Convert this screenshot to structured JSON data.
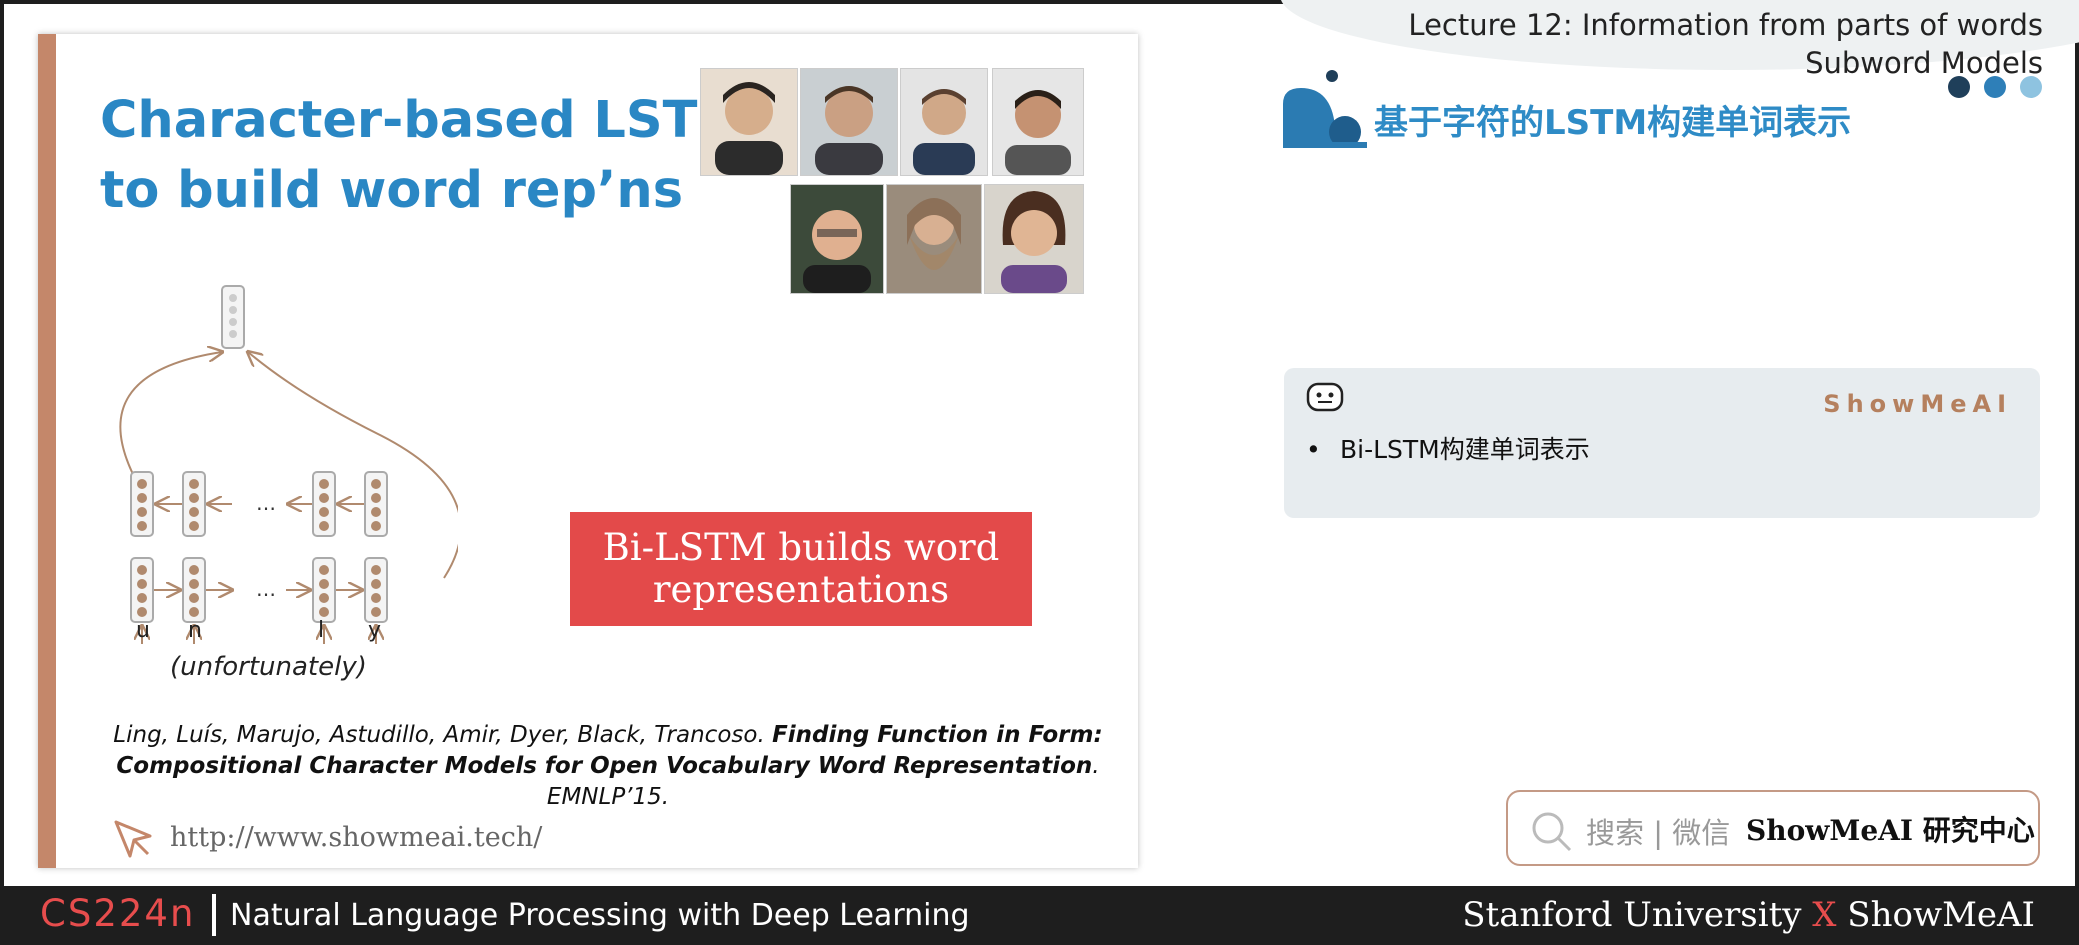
{
  "header": {
    "lecture_line1": "Lecture 12: Information from parts of words",
    "lecture_line2": "Subword Models",
    "cn_heading": "基于字符的LSTM构建单词表示",
    "dot_colors": [
      "#1f3f5a",
      "#2e7fb8",
      "#8ec3e0"
    ]
  },
  "slide": {
    "title_line1": "Character-based LSTM",
    "title_line2": "to build word rep’ns",
    "letters": [
      "u",
      "n",
      "l",
      "y"
    ],
    "ellipsis": "…",
    "word": "(unfortunately)",
    "callout_line1": "Bi-LSTM builds word",
    "callout_line2": "representations",
    "citation_authors": "Ling, Luís, Marujo, Astudillo, Amir, Dyer, Black, Trancoso. ",
    "citation_title1": "Finding Function in Form:",
    "citation_title2": "Compositional Character Models for Open Vocabulary Word Representation",
    "citation_venue": ". EMNLP’15.",
    "url": "http://www.showmeai.tech/",
    "accent_color": "#c4876a",
    "title_color": "#2a87c4",
    "callout_color": "#e34a4a"
  },
  "note": {
    "brand": "ShowMeAI",
    "bullet": "•",
    "item": "Bi-LSTM构建单词表示"
  },
  "search": {
    "label": "搜索 | 微信",
    "brand": "ShowMeAI 研究中心"
  },
  "footer": {
    "course": "CS224n",
    "desc": "Natural Language Processing with Deep Learning",
    "right_a": "Stanford University ",
    "right_x": "X",
    "right_b": " ShowMeAI"
  }
}
